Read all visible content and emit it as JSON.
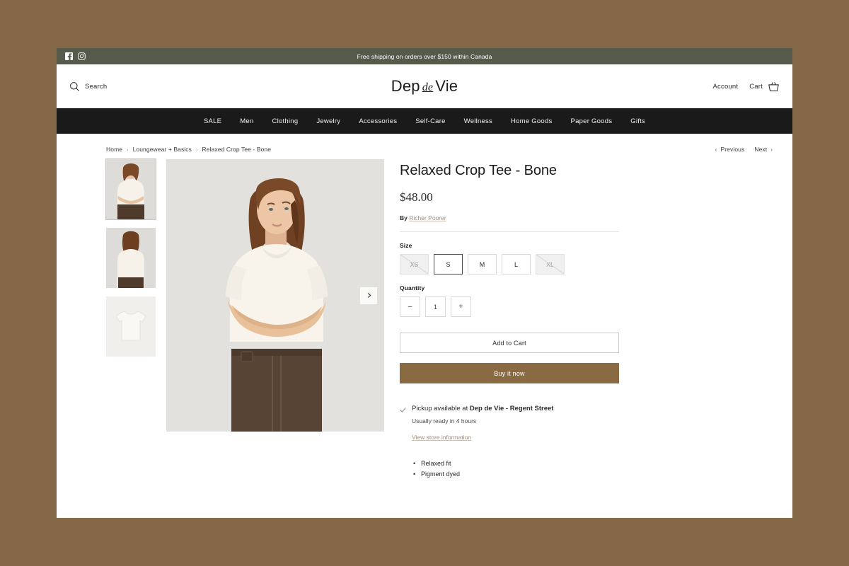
{
  "colors": {
    "page_background": "#856848",
    "announcement_bar": "#555a4b",
    "nav_bar": "#1a1a1a",
    "buy_button": "#8a6a43",
    "link_accent": "#9a8e80"
  },
  "announcement": {
    "text": "Free shipping on orders over $150 within Canada",
    "social": [
      {
        "name": "facebook-icon",
        "label": "Facebook"
      },
      {
        "name": "instagram-icon",
        "label": "Instagram"
      }
    ]
  },
  "header": {
    "search_label": "Search",
    "logo_first": "Dep",
    "logo_italic": "de",
    "logo_last": "Vie",
    "account_label": "Account",
    "cart_label": "Cart"
  },
  "nav": {
    "items": [
      {
        "label": "SALE"
      },
      {
        "label": "Men"
      },
      {
        "label": "Clothing"
      },
      {
        "label": "Jewelry"
      },
      {
        "label": "Accessories"
      },
      {
        "label": "Self-Care"
      },
      {
        "label": "Wellness"
      },
      {
        "label": "Home Goods"
      },
      {
        "label": "Paper Goods"
      },
      {
        "label": "Gifts"
      }
    ]
  },
  "breadcrumb": {
    "items": [
      {
        "label": "Home"
      },
      {
        "label": "Loungewear + Basics"
      },
      {
        "label": "Relaxed Crop Tee - Bone"
      }
    ],
    "separator": "›"
  },
  "pager": {
    "previous_label": "Previous",
    "next_label": "Next",
    "prev_chevron": "‹",
    "next_chevron": "›"
  },
  "gallery": {
    "thumbnails": [
      {
        "alt": "Model wearing relaxed crop tee front view",
        "active": true
      },
      {
        "alt": "Model wearing relaxed crop tee back view",
        "active": false
      },
      {
        "alt": "Flat lay of bone relaxed crop tee",
        "active": false
      }
    ],
    "main_image_alt": "Model with arms crossed wearing bone relaxed crop tee and brown trousers"
  },
  "product": {
    "title": "Relaxed Crop Tee - Bone",
    "price": "$48.00",
    "by_prefix": "By",
    "vendor": "Richer Poorer",
    "size_label": "Size",
    "sizes": [
      {
        "label": "XS",
        "state": "disabled"
      },
      {
        "label": "S",
        "state": "selected"
      },
      {
        "label": "M",
        "state": "available"
      },
      {
        "label": "L",
        "state": "available"
      },
      {
        "label": "XL",
        "state": "disabled"
      }
    ],
    "quantity_label": "Quantity",
    "quantity_value": "1",
    "decrease_symbol": "–",
    "increase_symbol": "+",
    "add_to_cart_label": "Add to Cart",
    "buy_now_label": "Buy it now",
    "features": [
      {
        "text": "Relaxed fit"
      },
      {
        "text": "Pigment dyed"
      }
    ]
  },
  "pickup": {
    "prefix": "Pickup available at",
    "location": "Dep de Vie - Regent Street",
    "ready_text": "Usually ready in 4 hours",
    "store_info_link": "View store information"
  }
}
